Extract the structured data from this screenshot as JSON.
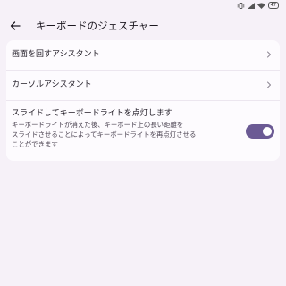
{
  "status_bar": {
    "battery": "47"
  },
  "header": {
    "title": "キーボードのジェスチャー",
    "back_icon": "arrow-back-icon"
  },
  "settings": [
    {
      "label": "画面を回すアシスタント",
      "icon": "chevron-right-icon"
    },
    {
      "label": "カーソルアシスタント",
      "icon": "chevron-right-icon"
    },
    {
      "label": "スライドしてキーボードライトを点灯します",
      "description_lines": [
        "キーボードライトが消えた後、キーボード上の長い距離を",
        "スライドさせることによってキーボードライトを再点灯させる",
        "ことができます"
      ],
      "toggle_on": true
    }
  ],
  "colors": {
    "background": "#f6f1f8",
    "card": "#fdfbfe",
    "toggle_accent": "#6b5a94"
  }
}
